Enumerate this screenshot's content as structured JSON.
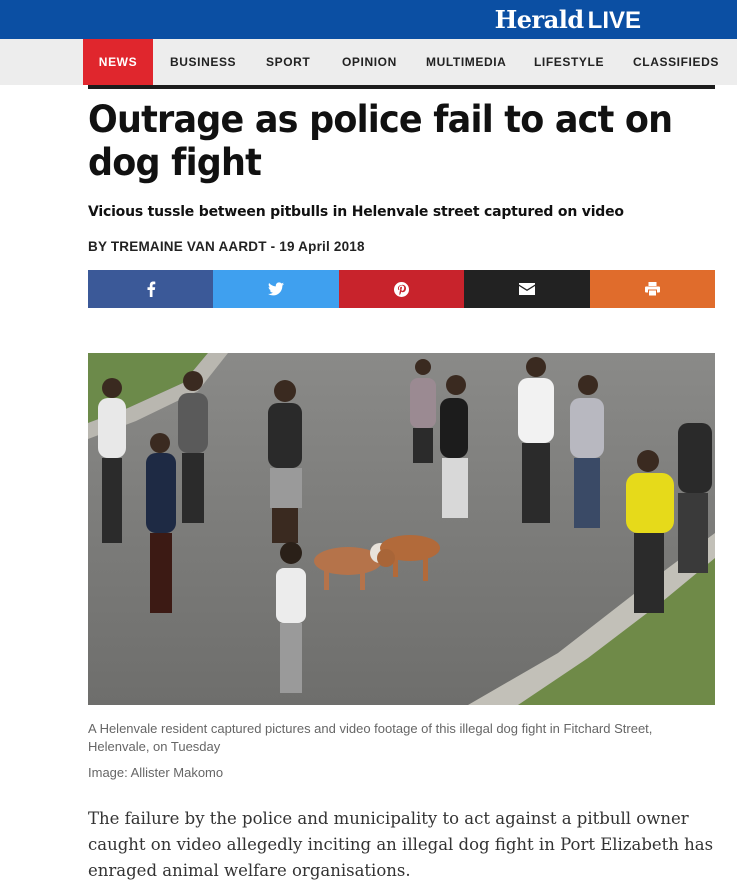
{
  "brand": {
    "name": "Herald",
    "suffix": "LIVE"
  },
  "nav": {
    "items": [
      {
        "label": "NEWS",
        "active": true
      },
      {
        "label": "BUSINESS"
      },
      {
        "label": "SPORT"
      },
      {
        "label": "OPINION"
      },
      {
        "label": "MULTIMEDIA"
      },
      {
        "label": "LIFESTYLE"
      },
      {
        "label": "CLASSIFIEDS"
      }
    ]
  },
  "article": {
    "headline": "Outrage as police fail to act on dog fight",
    "subheadline": "Vicious tussle between pitbulls in Helenvale street captured on video",
    "byline": "BY TREMAINE VAN AARDT - 19 April 2018",
    "share": [
      {
        "icon": "facebook-icon",
        "color": "#3b5998"
      },
      {
        "icon": "twitter-icon",
        "color": "#3fa0ef"
      },
      {
        "icon": "pinterest-icon",
        "color": "#c8232c"
      },
      {
        "icon": "email-icon",
        "color": "#222222"
      },
      {
        "icon": "print-icon",
        "color": "#e06c2c"
      }
    ],
    "caption": "A Helenvale resident captured pictures and video footage of this illegal dog fight in Fitchard Street, Helenvale, on Tuesday",
    "credit": "Image: Allister Makomo",
    "paragraph": "The failure by the police and municipality to act against a pitbull owner caught on video allegedly inciting an illegal dog fight in Port Elizabeth has enraged animal welfare organisations."
  },
  "colors": {
    "brand_blue": "#0b4fa3",
    "news_red": "#e0262d",
    "nav_bg": "#ededed"
  }
}
